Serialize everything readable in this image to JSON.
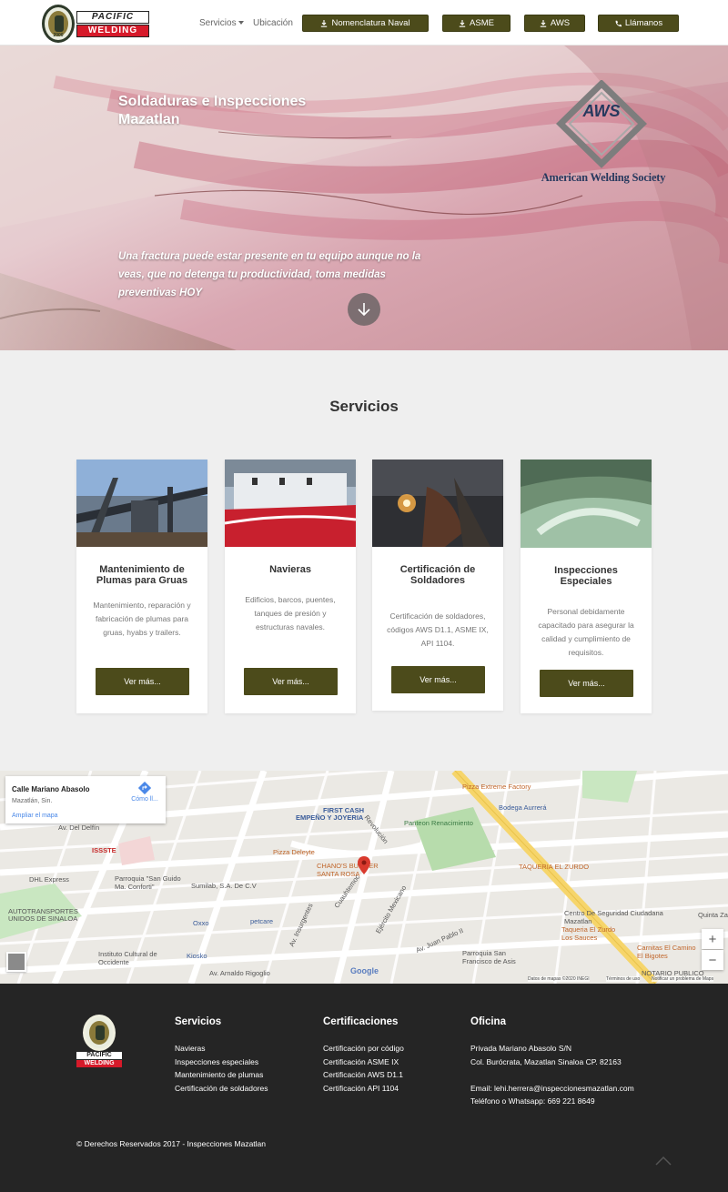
{
  "brand": {
    "line1": "PACIFIC",
    "line2": "WELDING",
    "seal_year": "2000"
  },
  "nav": {
    "servicios": "Servicios",
    "ubicacion": "Ubicación",
    "buttons": [
      {
        "label": "Nomenclatura Naval",
        "icon": "download-icon"
      },
      {
        "label": "ASME",
        "icon": "download-icon"
      },
      {
        "label": "AWS",
        "icon": "download-icon"
      },
      {
        "label": "Llámanos",
        "icon": "phone-icon"
      }
    ]
  },
  "hero": {
    "title": "Soldaduras e Inspecciones Mazatlan",
    "tagline": "Una fractura puede estar presente en tu equipo aunque no la veas, que no detenga tu productividad, toma medidas preventivas HOY",
    "aws_mark": "AWS",
    "aws_name": "American Welding Society"
  },
  "services": {
    "title": "Servicios",
    "cards": [
      {
        "title": "Mantenimiento de Plumas para Gruas",
        "text": "Mantenimiento, reparación y fabricación de plumas para gruas, hyabs y trailers.",
        "button": "Ver más..."
      },
      {
        "title": "Navieras",
        "text": "Edificios, barcos, puentes, tanques de presión y estructuras navales.",
        "button": "Ver más..."
      },
      {
        "title": "Certificación de Soldadores",
        "text": "Certificación de soldadores, códigos AWS D1.1, ASME IX, API 1104.",
        "button": "Ver más..."
      },
      {
        "title": "Inspecciones Especiales",
        "text": "Personal debidamente capacitado para asegurar la calidad y cumplimiento de requisitos.",
        "button": "Ver más..."
      }
    ]
  },
  "map": {
    "place_name": "Calle Mariano Abasolo",
    "place_sub": "Mazatlán, Sin.",
    "directions": "Cómo ll...",
    "enlarge": "Ampliar el mapa",
    "zoom_in": "+",
    "zoom_out": "−",
    "google": "Google",
    "attribution": "Datos de mapas ©2020 INEGI",
    "terms": "Términos de uso",
    "report": "Notificar un problema de Maps",
    "labels": [
      "Pizza Extreme Factory",
      "FIRST CASH",
      "EMPEÑO Y JOYERIA",
      "Panteon Renacimiento",
      "Bodega Aurrerá",
      "Pizza Deleyte",
      "CHANO'S BURGER",
      "SANTA ROSA",
      "TAQUERIA EL ZURDO",
      "ISSSTE",
      "DHL Express",
      "Parroquia \"San Guido Ma. Conforti\"",
      "Sumilab, S.A. De C.V",
      "AUTOTRANSPORTES",
      "UNIDOS DE SINALOA",
      "Oxxo",
      "petcare",
      "Instituto Cultural de Occidente",
      "Kiosko",
      "Av. Arnaldo Rigoglio",
      "Centro De Seguridad Ciudadana Mazatlan",
      "Taqueria El Zurdo Los Sauces",
      "Carnitas El Camino El Bigotes",
      "Parroquia San Francisco de Asis",
      "NOTARIO PUBLICO",
      "Av. Juan Pablo II",
      "Quinta Za",
      "Av. Insurgentes",
      "Revolución",
      "Av. Del Delfín",
      "Ejército Mexicano",
      "Cuauhtemoc"
    ]
  },
  "footer": {
    "col1": {
      "title": "Servicios",
      "links": [
        "Navieras",
        "Inspecciones especiales",
        "Mantenimiento de plumas",
        "Certificación de soldadores"
      ]
    },
    "col2": {
      "title": "Certificaciones",
      "links": [
        "Certificación por código",
        "Certificación ASME IX",
        "Certificación AWS D1.1",
        "Certificación API 1104"
      ]
    },
    "col3": {
      "title": "Oficina",
      "lines": [
        "Privada Mariano Abasolo S/N",
        "Col. Burócrata, Mazatlan Sinaloa CP. 82163",
        "",
        "Email: lehi.herrera@inspeccionesmazatlan.com",
        "Teléfono o Whatsapp: 669 221 8649"
      ]
    },
    "copyright": "© Derechos Reservados 2017 - Inspecciones Mazatlan"
  },
  "colors": {
    "primary_button": "#4c4b1b",
    "footer_bg": "#252525",
    "brand_red": "#d61a2a"
  }
}
